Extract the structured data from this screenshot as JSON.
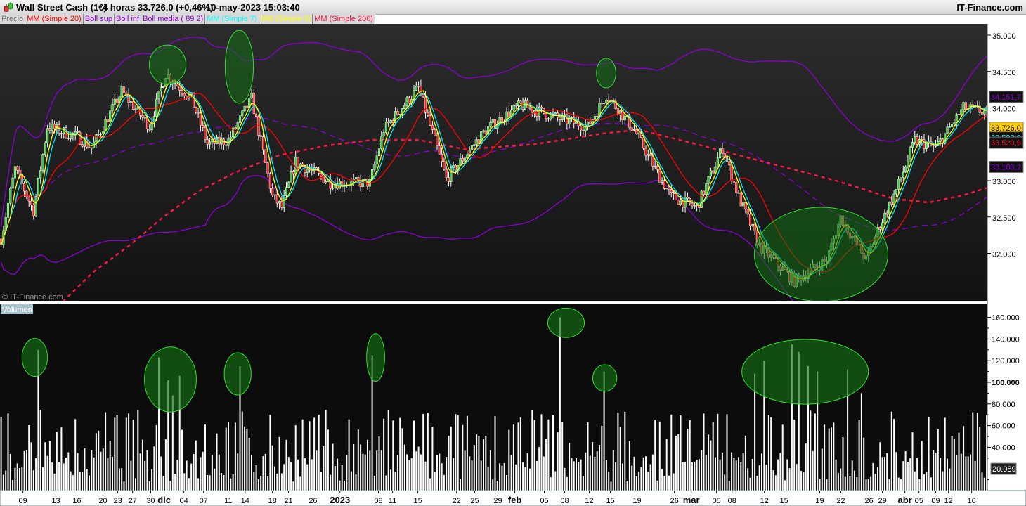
{
  "window": {
    "instrument": "Wall Street Cash (1€)",
    "timeframe": "4 horas",
    "last_price": "33.726,0 (+0,46%)",
    "datetime": "10-may-2023 15:03:40",
    "brand": "IT-Finance.com",
    "watermark": "© IT-Finance.com"
  },
  "legend": [
    {
      "label": "Precio",
      "color": "#777777"
    },
    {
      "label": "MM (Simple 20)",
      "color": "#ff0000"
    },
    {
      "label": "Boll sup",
      "color": "#8a00d4"
    },
    {
      "label": "Boll inf",
      "color": "#8a00d4"
    },
    {
      "label": "Boll media ( 89 2)",
      "color": "#8a00d4"
    },
    {
      "label": "MM (Simple 7)",
      "color": "#00ffff"
    },
    {
      "label": "MM (Simple 5)",
      "color": "#ffff00"
    },
    {
      "label": "MM (Simple 200)",
      "color": "#ff1040"
    }
  ],
  "volume_label": "Volumen",
  "colors": {
    "up": "#33cc33",
    "down": "#ff1a1a",
    "ma20": "#ff0000",
    "ma7": "#00e5ff",
    "ma5": "#ffff00",
    "ma200": "#ff1744",
    "boll": "#8a00d4",
    "annotation": "#33dd33"
  },
  "chart_data": [
    {
      "type": "candlestick",
      "title": "Wall Street Cash (1€) 4 horas",
      "bars": 426,
      "ylim": [
        31350,
        35350
      ],
      "y_ticks": [
        "35.000",
        "34.500",
        "34.000",
        "33.000",
        "32.500",
        "32.000"
      ],
      "y_tick_values": [
        35000,
        34500,
        34000,
        33000,
        32500,
        32000
      ],
      "close_keypoints": [
        [
          0,
          32200
        ],
        [
          6,
          33165
        ],
        [
          14,
          32585
        ],
        [
          20,
          33744
        ],
        [
          33,
          33600
        ],
        [
          39,
          33450
        ],
        [
          52,
          34227
        ],
        [
          64,
          33744
        ],
        [
          71,
          34469
        ],
        [
          82,
          34130
        ],
        [
          89,
          33500
        ],
        [
          98,
          33550
        ],
        [
          108,
          34130
        ],
        [
          117,
          32780
        ],
        [
          121,
          32630
        ],
        [
          127,
          33260
        ],
        [
          142,
          32970
        ],
        [
          159,
          32970
        ],
        [
          165,
          33700
        ],
        [
          180,
          34280
        ],
        [
          192,
          33020
        ],
        [
          209,
          33700
        ],
        [
          224,
          34040
        ],
        [
          242,
          33840
        ],
        [
          253,
          33744
        ],
        [
          261,
          34180
        ],
        [
          273,
          33700
        ],
        [
          282,
          33165
        ],
        [
          289,
          32780
        ],
        [
          300,
          32630
        ],
        [
          311,
          33450
        ],
        [
          318,
          32780
        ],
        [
          327,
          32100
        ],
        [
          342,
          31620
        ],
        [
          356,
          31910
        ],
        [
          362,
          32490
        ],
        [
          373,
          31910
        ],
        [
          379,
          32390
        ],
        [
          386,
          32870
        ],
        [
          394,
          33550
        ],
        [
          403,
          33450
        ],
        [
          415,
          34000
        ],
        [
          425,
          33940
        ]
      ],
      "ma200_keypoints": [
        [
          27,
          31350
        ],
        [
          40,
          31750
        ],
        [
          55,
          32100
        ],
        [
          70,
          32500
        ],
        [
          85,
          32850
        ],
        [
          100,
          33100
        ],
        [
          120,
          33350
        ],
        [
          140,
          33480
        ],
        [
          160,
          33560
        ],
        [
          180,
          33560
        ],
        [
          200,
          33430
        ],
        [
          230,
          33500
        ],
        [
          260,
          33650
        ],
        [
          275,
          33700
        ],
        [
          300,
          33500
        ],
        [
          330,
          33250
        ],
        [
          360,
          33000
        ],
        [
          385,
          32750
        ],
        [
          400,
          32700
        ],
        [
          415,
          32800
        ],
        [
          425,
          32900
        ]
      ],
      "price_tags": [
        {
          "label": "34.151,7",
          "value": 34151.7,
          "series": "Boll sup",
          "bg": "#111111",
          "fg": "#8a00d4"
        },
        {
          "label": "33.726,0",
          "value": 33726.0,
          "series": "Precio",
          "bg": "#ffcc00",
          "fg": "#000000"
        },
        {
          "label": "33.593,0",
          "value": 33593.0,
          "series": "MM (Simple 7)",
          "bg": "#111111",
          "fg": "#00ffff"
        },
        {
          "label": "33.520,9",
          "value": 33520.9,
          "series": "MM (Simple 20)",
          "bg": "#111111",
          "fg": "#ff1a3a"
        },
        {
          "label": "33.188,2",
          "value": 33188.2,
          "series": "Boll inf",
          "bg": "#111111",
          "fg": "#8a00d4"
        }
      ],
      "annotations": [
        {
          "bar": 71.8,
          "price": 34594,
          "half_bars": 7.9,
          "half_price": 270
        },
        {
          "bar": 102.7,
          "price": 34565,
          "half_bars": 6.1,
          "half_price": 502
        },
        {
          "bar": 260.9,
          "price": 34478,
          "half_bars": 4.2,
          "half_price": 203
        },
        {
          "bar": 353.6,
          "price": 31986,
          "half_bars": 28.8,
          "half_price": 647
        }
      ]
    },
    {
      "type": "bar",
      "title": "Volumen",
      "ylim": [
        0,
        172000
      ],
      "y_ticks": [
        "160.000",
        "140.000",
        "120.000",
        "100.000",
        "80.000",
        "60.000",
        "40.000"
      ],
      "y_tick_values": [
        160000,
        140000,
        120000,
        100000,
        80000,
        60000,
        40000
      ],
      "last_value_tag": "20.089",
      "spikes": [
        [
          16,
          130000
        ],
        [
          68,
          123000
        ],
        [
          72,
          102000
        ],
        [
          74,
          88000
        ],
        [
          77,
          106000
        ],
        [
          103,
          115000
        ],
        [
          160,
          125000
        ],
        [
          241,
          160000
        ],
        [
          260,
          110000
        ],
        [
          325,
          108000
        ],
        [
          329,
          120000
        ],
        [
          341,
          135000
        ],
        [
          344,
          128000
        ],
        [
          348,
          115000
        ],
        [
          352,
          110000
        ],
        [
          365,
          112000
        ],
        [
          371,
          90000
        ]
      ],
      "annotations": [
        {
          "bar": 14.5,
          "volume": 123000,
          "half_bars": 5.5,
          "half_volume": 17500
        },
        {
          "bar": 73,
          "volume": 102600,
          "half_bars": 11.2,
          "half_volume": 30000
        },
        {
          "bar": 102,
          "volume": 107800,
          "half_bars": 5.8,
          "half_volume": 19500
        },
        {
          "bar": 161.5,
          "volume": 123000,
          "half_bars": 3.9,
          "half_volume": 22000
        },
        {
          "bar": 243.6,
          "volume": 155000,
          "half_bars": 7.9,
          "half_volume": 13600
        },
        {
          "bar": 260.3,
          "volume": 103900,
          "half_bars": 5.2,
          "half_volume": 12300
        },
        {
          "bar": 346.7,
          "volume": 109700,
          "half_bars": 27.3,
          "half_volume": 29900
        }
      ]
    }
  ],
  "x_ticks": [
    {
      "label": "09",
      "bar": 9.4
    },
    {
      "label": "13",
      "bar": 23.6
    },
    {
      "label": "16",
      "bar": 32.7
    },
    {
      "label": "20",
      "bar": 43.9
    },
    {
      "label": "23",
      "bar": 50.3
    },
    {
      "label": "27",
      "bar": 56.7
    },
    {
      "label": "30",
      "bar": 64.5
    },
    {
      "label": "dic",
      "bar": 70.3,
      "bold": true
    },
    {
      "label": "04",
      "bar": 78.8
    },
    {
      "label": "07",
      "bar": 87.3
    },
    {
      "label": "11",
      "bar": 97.9
    },
    {
      "label": "14",
      "bar": 105.2
    },
    {
      "label": "18",
      "bar": 117
    },
    {
      "label": "21",
      "bar": 123.9
    },
    {
      "label": "26",
      "bar": 134.5
    },
    {
      "label": "2023",
      "bar": 146.1,
      "bold": true
    },
    {
      "label": "08",
      "bar": 162.7
    },
    {
      "label": "11",
      "bar": 168.8
    },
    {
      "label": "15",
      "bar": 179.7
    },
    {
      "label": "22",
      "bar": 196.4
    },
    {
      "label": "25",
      "bar": 204.2
    },
    {
      "label": "29",
      "bar": 214.2
    },
    {
      "label": "feb",
      "bar": 221.5,
      "bold": true
    },
    {
      "label": "05",
      "bar": 234.2
    },
    {
      "label": "08",
      "bar": 243
    },
    {
      "label": "12",
      "bar": 253.6
    },
    {
      "label": "15",
      "bar": 262.7
    },
    {
      "label": "19",
      "bar": 274.2
    },
    {
      "label": "26",
      "bar": 290.3
    },
    {
      "label": "mar",
      "bar": 297.6,
      "bold": true
    },
    {
      "label": "05",
      "bar": 308.5
    },
    {
      "label": "08",
      "bar": 315.2
    },
    {
      "label": "12",
      "bar": 329.1
    },
    {
      "label": "15",
      "bar": 337.6
    },
    {
      "label": "19",
      "bar": 353
    },
    {
      "label": "22",
      "bar": 362.1
    },
    {
      "label": "26",
      "bar": 374.2
    },
    {
      "label": "29",
      "bar": 380
    },
    {
      "label": "abr",
      "bar": 389.7,
      "bold": true
    },
    {
      "label": "05",
      "bar": 395.8
    },
    {
      "label": "09",
      "bar": 403
    },
    {
      "label": "12",
      "bar": 408.5
    },
    {
      "label": "16",
      "bar": 418.5
    }
  ]
}
